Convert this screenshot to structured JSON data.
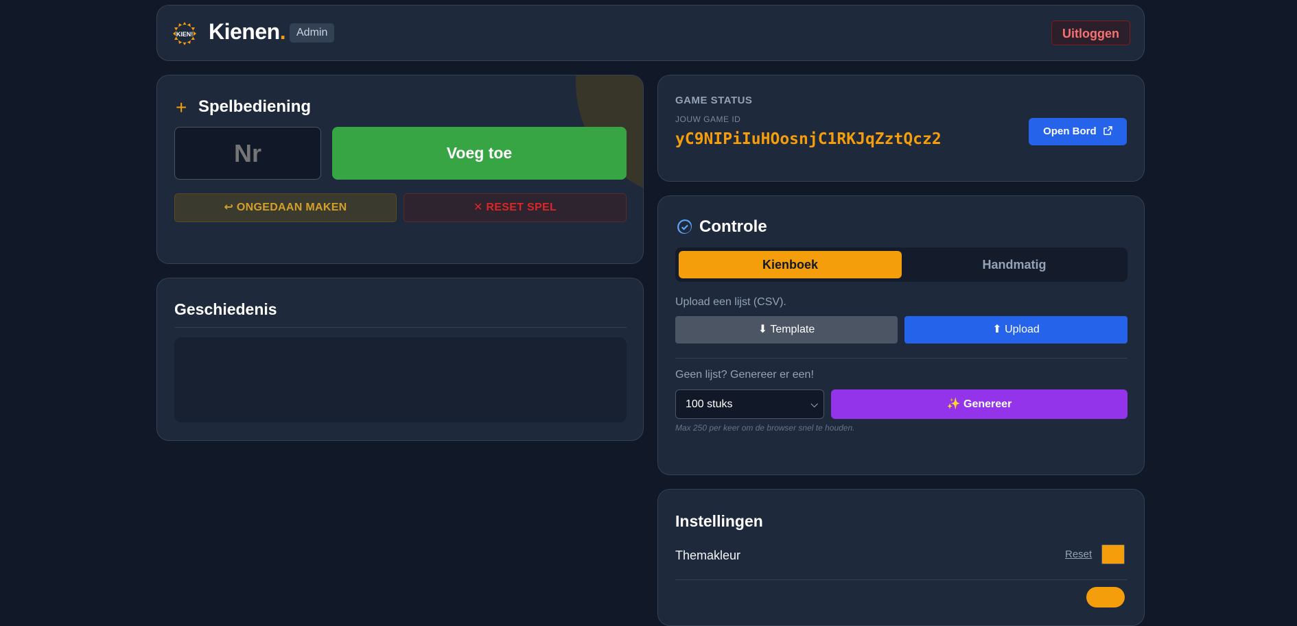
{
  "header": {
    "logo_text": "KIEN!",
    "brand": "Kienen",
    "brand_dot": ".",
    "badge": "Admin",
    "logout_label": "Uitloggen"
  },
  "controls": {
    "title": "Spelbediening",
    "number_placeholder": "Nr",
    "add_label": "Voeg toe",
    "undo_label": "↩ ONGEDAAN MAKEN",
    "reset_label": "✕ RESET SPEL"
  },
  "history": {
    "title": "Geschiedenis"
  },
  "status": {
    "heading": "GAME STATUS",
    "id_label": "JOUW GAME ID",
    "game_id": "yC9NIPiIuHOosnjC1RKJqZztQcz2",
    "open_label": "Open Bord"
  },
  "check": {
    "title": "Controle",
    "tabs": [
      {
        "label": "Kienboek",
        "active": true
      },
      {
        "label": "Handmatig",
        "active": false
      }
    ],
    "upload_hint": "Upload een lijst (CSV).",
    "template_label": "⬇ Template",
    "upload_label": "⬆ Upload",
    "generate_hint": "Geen lijst? Genereer er een!",
    "select_value": "100 stuks",
    "generate_label": "✨ Genereer",
    "max_note": "Max 250 per keer om de browser snel te houden."
  },
  "settings": {
    "title": "Instellingen",
    "theme_label": "Themakleur",
    "reset_link": "Reset",
    "theme_color": "#f59e0b"
  },
  "colors": {
    "accent": "#f59e0b",
    "background": "#111827",
    "card": "#1e293b",
    "success": "#38a545",
    "primary": "#2563eb",
    "purple": "#9333ea",
    "danger": "#dc2626"
  }
}
